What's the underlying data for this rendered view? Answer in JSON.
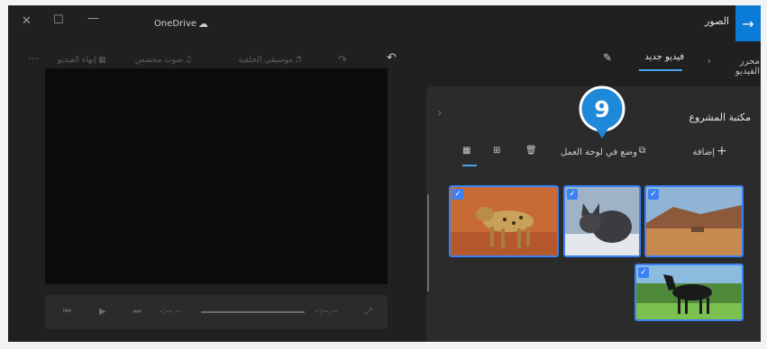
{
  "window": {
    "app_title": "الصور",
    "cloud_label": "OneDrive",
    "back_icon": "arrow-right-icon"
  },
  "breadcrumb": {
    "parent": "محرر الفيديو",
    "current": "فيديو جديد"
  },
  "toolbar": {
    "finish_video": "إنهاء الفيديو",
    "custom_audio": "صوت مخصص",
    "background_music": "موسيقى الخلفية"
  },
  "player": {
    "current_time": "-:--.--",
    "total_time": "-:--.--"
  },
  "project_library": {
    "title": "مكتبة المشروع",
    "add_label": "إضافة",
    "place_label": "وضع في لوحة العمل"
  },
  "media": [
    {
      "name": "leopard",
      "selected": true
    },
    {
      "name": "cat",
      "selected": true
    },
    {
      "name": "desert-camel",
      "selected": true
    },
    {
      "name": "horse",
      "selected": true
    }
  ],
  "annotation": {
    "step_number": "9"
  },
  "colors": {
    "accent": "#0a7bd6",
    "selection": "#3b82f6",
    "callout": "#1e88d9"
  }
}
